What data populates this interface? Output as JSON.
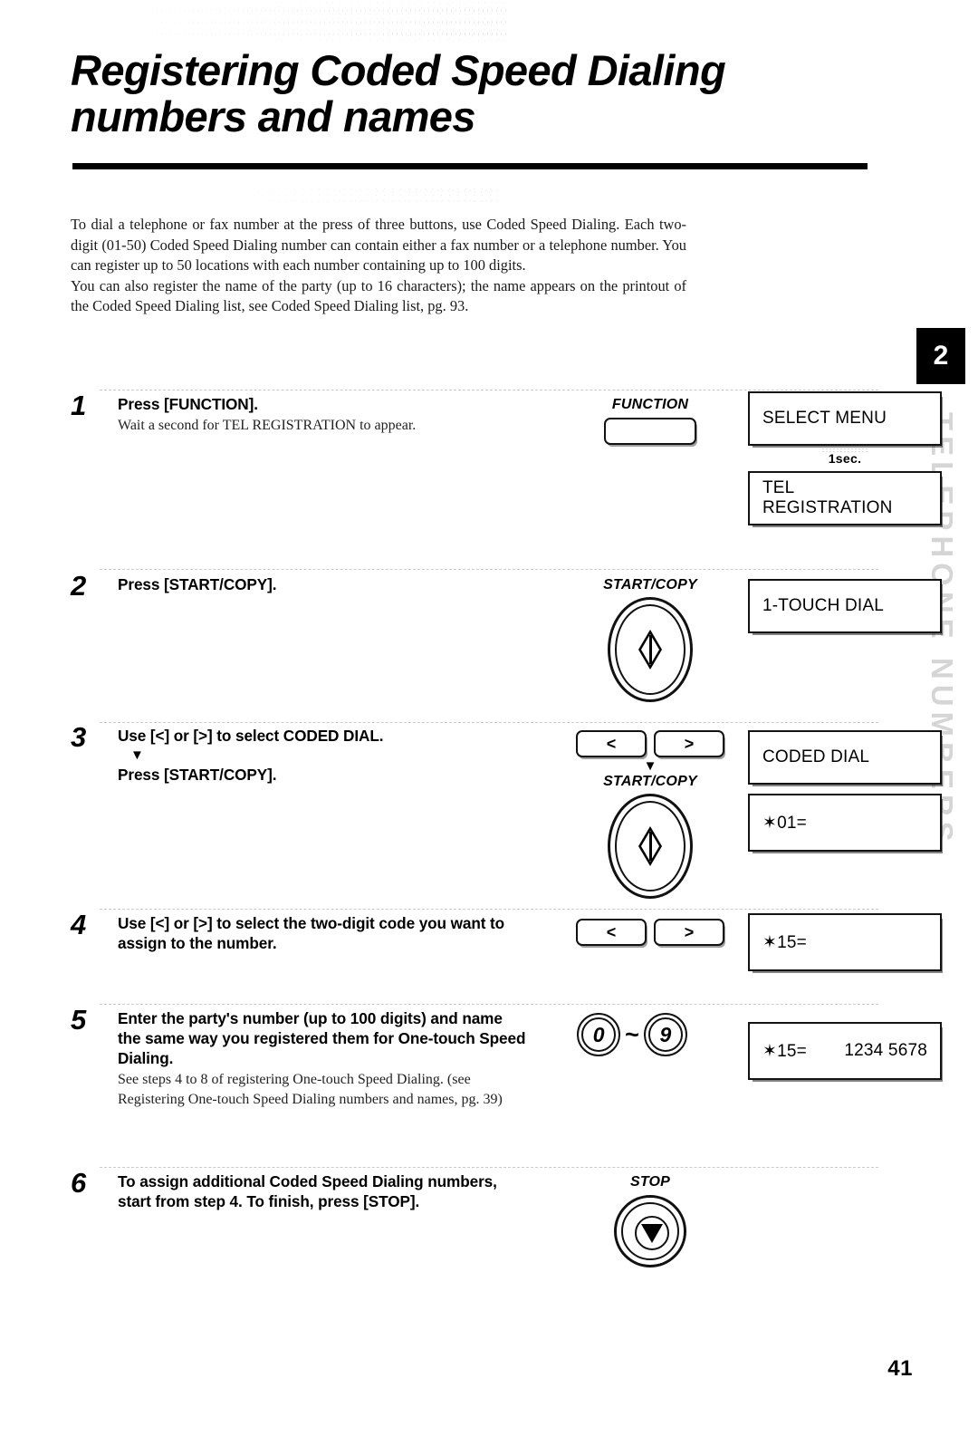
{
  "page": {
    "title_lines": [
      "Registering Coded Speed Dialing",
      "numbers and names"
    ],
    "chapter_tab": "2",
    "side_vertical_text": "TELEPHONE NUMBERS",
    "page_number": "41"
  },
  "intro": {
    "paragraph1": "To dial a telephone or fax number at the press of three buttons, use Coded Speed Dialing.  Each two-digit (01-50) Coded Speed Dialing number can contain either a fax number or a telephone number.  You can register up to 50 locations with each number containing up to 100 digits.",
    "paragraph2": "You can also register the name of the party (up to 16 characters); the name appears on the printout of the Coded Speed Dialing list, see Coded Speed Dialing list, pg. 93."
  },
  "steps": [
    {
      "number": "1",
      "main": "Press [FUNCTION].",
      "sub": "Wait a second for TEL REGISTRATION to appear.",
      "key_label": "FUNCTION",
      "lcd1": "SELECT MENU",
      "sec_note": "1sec.",
      "lcd2": "TEL REGISTRATION"
    },
    {
      "number": "2",
      "main": "Press [START/COPY].",
      "key_label": "START/COPY",
      "lcd1": "1-TOUCH DIAL"
    },
    {
      "number": "3",
      "main": "Use [<] or [>] to select CODED DIAL.",
      "main2": "Press [START/COPY].",
      "arrow_left": "<",
      "arrow_right": ">",
      "key_label": "START/COPY",
      "lcd1": "CODED DIAL",
      "lcd2": "✶01="
    },
    {
      "number": "4",
      "main": "Use [<] or [>] to select the two-digit code you want to assign to the number.",
      "arrow_left": "<",
      "arrow_right": ">",
      "lcd1": "✶15="
    },
    {
      "number": "5",
      "main": "Enter the party's number (up to 100 digits) and name the same way you registered them for One-touch Speed Dialing.",
      "sub": "See steps 4 to 8 of registering One-touch Speed Dialing. (see Registering One-touch Speed Dialing numbers and names, pg. 39)",
      "keypad_from": "0",
      "keypad_tilde": "~",
      "keypad_to": "9",
      "lcd_code": "✶15=",
      "lcd_value": "1234 5678"
    },
    {
      "number": "6",
      "main": "To assign additional Coded Speed Dialing numbers, start from step 4. To finish, press [STOP].",
      "key_label": "STOP"
    }
  ]
}
